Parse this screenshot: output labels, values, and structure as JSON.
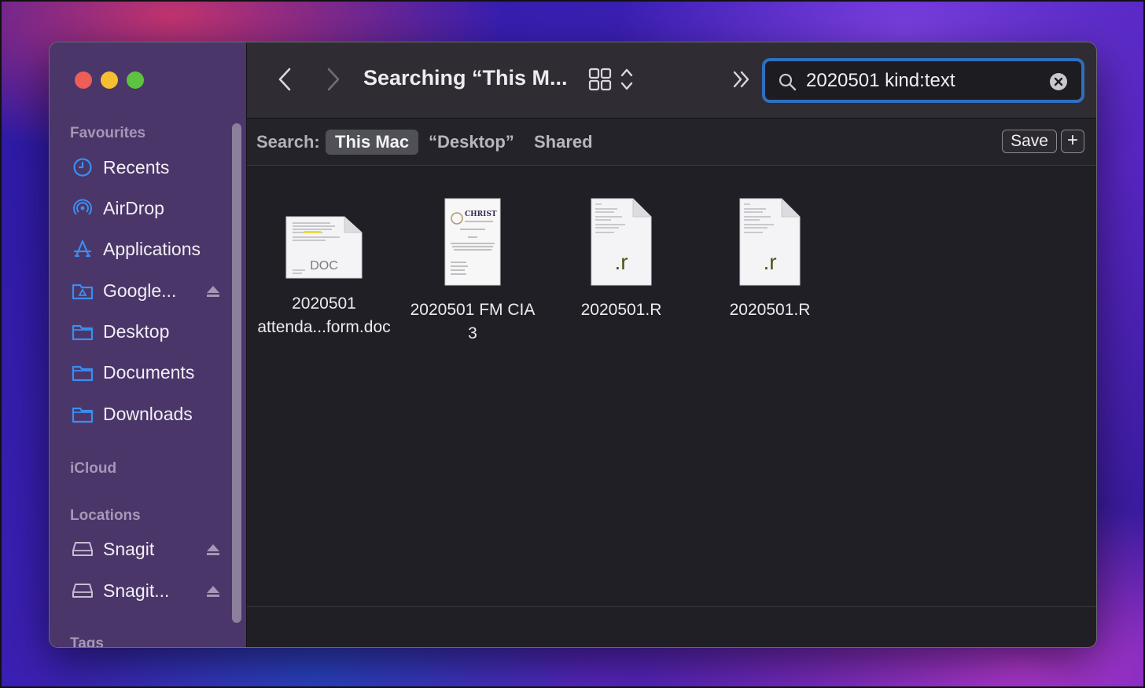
{
  "window": {
    "title": "Searching “This M...",
    "search": {
      "value": "2020501 kind:text"
    }
  },
  "sidebar": {
    "sections": {
      "favourites": "Favourites",
      "icloud": "iCloud",
      "locations": "Locations",
      "tags": "Tags"
    },
    "favourites": [
      {
        "label": "Recents",
        "icon": "clock-icon"
      },
      {
        "label": "AirDrop",
        "icon": "airdrop-icon"
      },
      {
        "label": "Applications",
        "icon": "applications-icon"
      },
      {
        "label": "Google...",
        "icon": "google-drive-folder-icon"
      },
      {
        "label": "Desktop",
        "icon": "folder-icon"
      },
      {
        "label": "Documents",
        "icon": "folder-icon"
      },
      {
        "label": "Downloads",
        "icon": "folder-icon"
      }
    ],
    "locations": [
      {
        "label": "Snagit",
        "icon": "drive-icon"
      },
      {
        "label": "Snagit...",
        "icon": "drive-icon"
      }
    ]
  },
  "scopebar": {
    "label": "Search:",
    "scopes": [
      "This Mac",
      "“Desktop”",
      "Shared"
    ],
    "active_scope": "This Mac",
    "save_label": "Save",
    "add_label": "+"
  },
  "files": [
    {
      "name_line1": "2020501",
      "name_line2": "attenda...form.doc",
      "type_badge": "DOC"
    },
    {
      "name_line1": "2020501 FM CIA",
      "name_line2": "3",
      "preview_heading": "CHRIST"
    },
    {
      "name_line1": "2020501.R",
      "name_line2": "",
      "type_badge": ".r"
    },
    {
      "name_line1": "2020501.R",
      "name_line2": "",
      "type_badge": ".r"
    }
  ],
  "colors": {
    "accent": "#2f6fbf",
    "sidebar_icon": "#3b8ef0",
    "sidebar_bg": "#4a3668"
  }
}
